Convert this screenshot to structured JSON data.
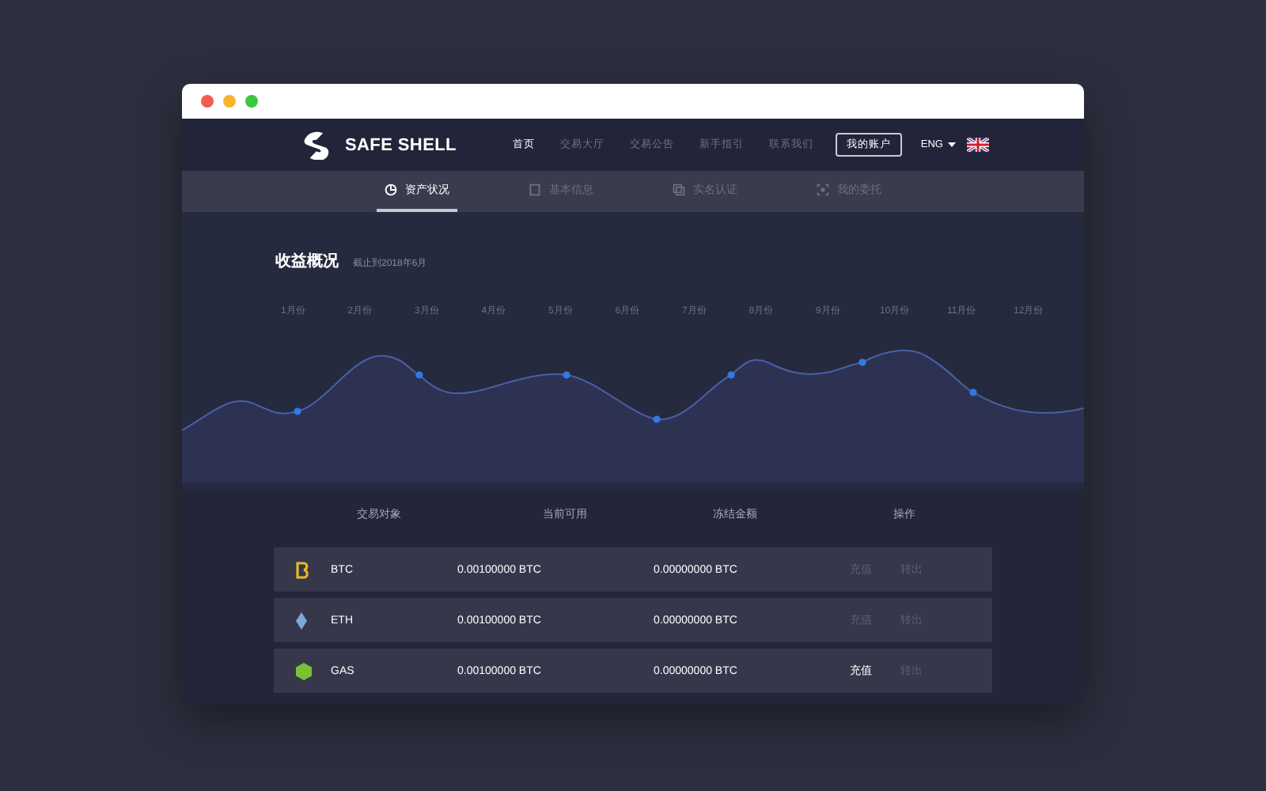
{
  "nav": {
    "logo": "SAFE SHELL",
    "items": [
      {
        "label": "首页",
        "selected": true
      },
      {
        "label": "交易大厅",
        "selected": false
      },
      {
        "label": "交易公告",
        "selected": false
      },
      {
        "label": "新手指引",
        "selected": false
      },
      {
        "label": "联系我们",
        "selected": false
      }
    ],
    "account_button": "我的账户",
    "language": "ENG"
  },
  "tabs": [
    {
      "label": "资产状况",
      "selected": true
    },
    {
      "label": "基本信息",
      "selected": false
    },
    {
      "label": "实名认证",
      "selected": false
    },
    {
      "label": "我的委托",
      "selected": false
    }
  ],
  "earnings": {
    "title": "收益概况",
    "subtitle": "截止到2018年6月",
    "months": [
      "1月份",
      "2月份",
      "3月份",
      "4月份",
      "5月份",
      "6月份",
      "7月份",
      "8月份",
      "9月份",
      "10月份",
      "11月份",
      "12月份"
    ]
  },
  "table": {
    "columns": [
      "交易对象",
      "当前可用",
      "冻结金额",
      "操作"
    ],
    "rows": [
      {
        "symbol": "BTC",
        "color": "#e8b923",
        "available": "0.00100000 BTC",
        "frozen": "0.00000000 BTC",
        "actions": [
          {
            "label": "充值",
            "active": false
          },
          {
            "label": "转出",
            "active": false
          }
        ]
      },
      {
        "symbol": "ETH",
        "color": "#7fa7d8",
        "available": "0.00100000 BTC",
        "frozen": "0.00000000 BTC",
        "actions": [
          {
            "label": "充值",
            "active": false
          },
          {
            "label": "转出",
            "active": false
          }
        ]
      },
      {
        "symbol": "GAS",
        "color": "#7ac231",
        "available": "0.00100000 BTC",
        "frozen": "0.00000000 BTC",
        "actions": [
          {
            "label": "充值",
            "active": true
          },
          {
            "label": "转出",
            "active": false
          }
        ]
      }
    ]
  }
}
